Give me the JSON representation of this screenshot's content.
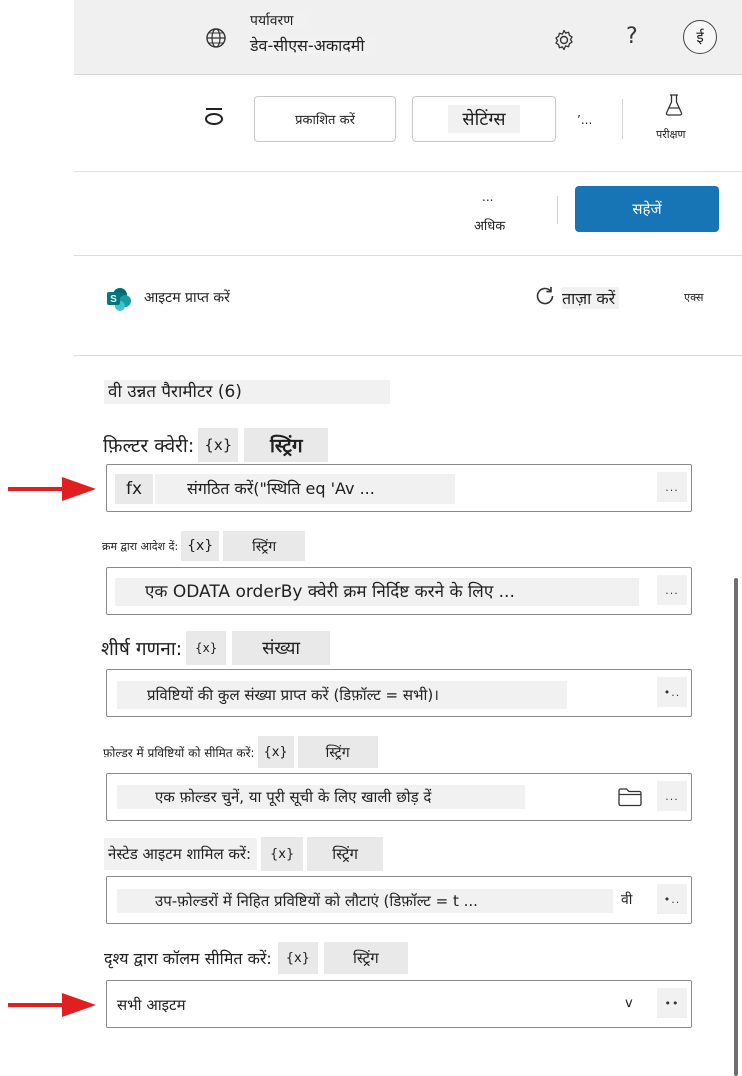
{
  "header": {
    "env_label": "पर्यावरण",
    "env_name": "डेव-सीएस-अकादमी",
    "help_label": "?",
    "avatar_initial": "ई"
  },
  "commandbar": {
    "publish_label": "प्रकाशित करें",
    "settings_label": "सेटिंग्स",
    "overflow_label": "’...",
    "test_label": "परीक्षण",
    "more_dots": "...",
    "more_label": "अधिक",
    "save_label": "सहेजें"
  },
  "action": {
    "title": "आइटम प्राप्त करें",
    "refresh_label": "ताज़ा करें",
    "extra_label": "एक्स"
  },
  "advanced": {
    "heading": "वी उन्नत पैरामीटर (6)"
  },
  "params": [
    {
      "label": "फ़िल्टर क्वेरी:",
      "token": "{x}",
      "type": "स्ट्रिंग",
      "fx": "fx",
      "value": "संगठित करें(\"स्थिति eq 'Av ...",
      "more": "...",
      "trail": ""
    },
    {
      "label": "क्रम द्वारा आदेश दें:",
      "token": "{x}",
      "type": "स्ट्रिंग",
      "value": "एक ODATA orderBy क्वेरी क्रम निर्दिष्ट करने के लिए ...",
      "more": "...",
      "trail": ""
    },
    {
      "label": "शीर्ष गणना:",
      "token": "{x}",
      "type": "संख्या",
      "value": "प्रविष्टियों की कुल संख्या प्राप्त करें (डिफ़ॉल्ट = सभी)।",
      "more": "•..",
      "trail": ""
    },
    {
      "label": "फ़ोल्डर में प्रविष्टियों को सीमित करें:",
      "token": "{x}",
      "type": "स्ट्रिंग",
      "value": "एक फ़ोल्डर चुनें, या पूरी सूची के लिए खाली छोड़ दें",
      "more": "...",
      "trail": ""
    },
    {
      "label": "नेस्टेड आइटम शामिल करें:",
      "token": "{x}",
      "type": "स्ट्रिंग",
      "value": "उप-फ़ोल्डरों में निहित प्रविष्टियों को लौटाएं (डिफ़ॉल्ट = t ...",
      "more": "•..",
      "trail": "वी"
    },
    {
      "label": "दृश्य द्वारा कॉलम सीमित करें:",
      "token": "{x}",
      "type": "स्ट्रिंग",
      "value": "सभी आइटम",
      "more": "••",
      "trail": "v"
    }
  ],
  "colors": {
    "accent": "#0f6cbd",
    "arrow": "#e02020",
    "sharepoint": "#038387"
  },
  "icons": [
    "globe-icon",
    "gear-icon",
    "flask-icon",
    "sharepoint-icon",
    "refresh-icon",
    "folder-icon",
    "arrow-right-icon"
  ]
}
